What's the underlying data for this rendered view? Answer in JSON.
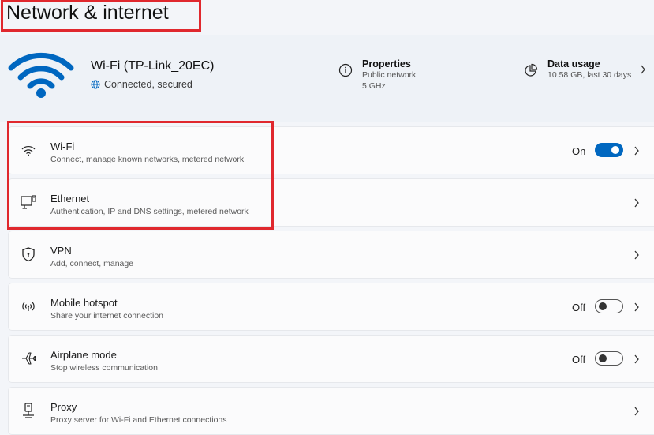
{
  "page": {
    "title": "Network & internet"
  },
  "connection": {
    "name": "Wi-Fi (TP-Link_20EC)",
    "status": "Connected, secured",
    "properties": {
      "title": "Properties",
      "line1": "Public network",
      "line2": "5 GHz",
      "icon": "info-icon"
    },
    "data_usage": {
      "title": "Data usage",
      "line1": "10.58 GB, last 30 days",
      "icon": "pie-chart-icon"
    }
  },
  "rows": [
    {
      "title": "Wi-Fi",
      "subtitle": "Connect, manage known networks, metered network",
      "state": "On",
      "toggle": true,
      "icon": "wifi-icon"
    },
    {
      "title": "Ethernet",
      "subtitle": "Authentication, IP and DNS settings, metered network",
      "icon": "ethernet-icon"
    },
    {
      "title": "VPN",
      "subtitle": "Add, connect, manage",
      "icon": "shield-icon"
    },
    {
      "title": "Mobile hotspot",
      "subtitle": "Share your internet connection",
      "state": "Off",
      "toggle": false,
      "icon": "hotspot-icon"
    },
    {
      "title": "Airplane mode",
      "subtitle": "Stop wireless communication",
      "state": "Off",
      "toggle": false,
      "icon": "airplane-icon"
    },
    {
      "title": "Proxy",
      "subtitle": "Proxy server for Wi-Fi and Ethernet connections",
      "icon": "proxy-icon"
    }
  ],
  "colors": {
    "accent": "#0067c0",
    "highlight": "#e0282e"
  }
}
